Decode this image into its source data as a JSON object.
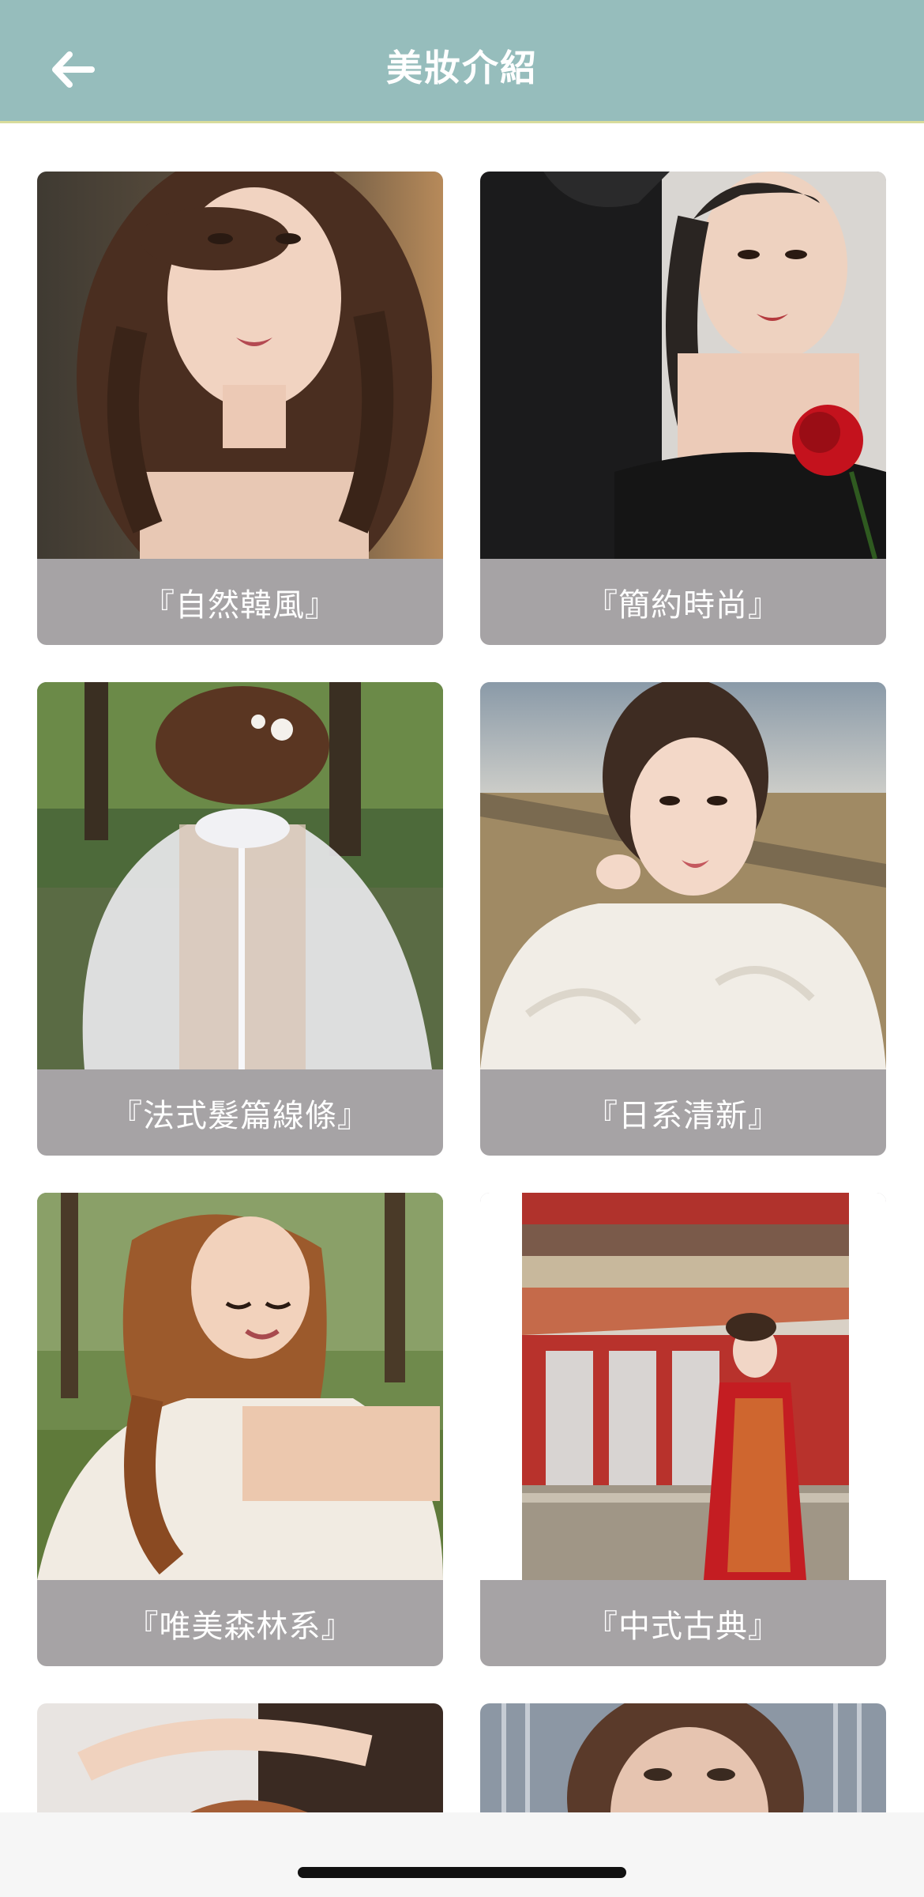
{
  "header": {
    "title": "美妝介紹",
    "back_icon": "arrow-left-icon",
    "background": "#96bdbc"
  },
  "cards": [
    {
      "label": "『自然韓風』"
    },
    {
      "label": "『簡約時尚』"
    },
    {
      "label": "『法式髮篇線條』"
    },
    {
      "label": "『日系清新』"
    },
    {
      "label": "『唯美森林系』"
    },
    {
      "label": "『中式古典』"
    }
  ],
  "colors": {
    "caption_bg": "#a6a3a5",
    "caption_text": "#ffffff"
  }
}
